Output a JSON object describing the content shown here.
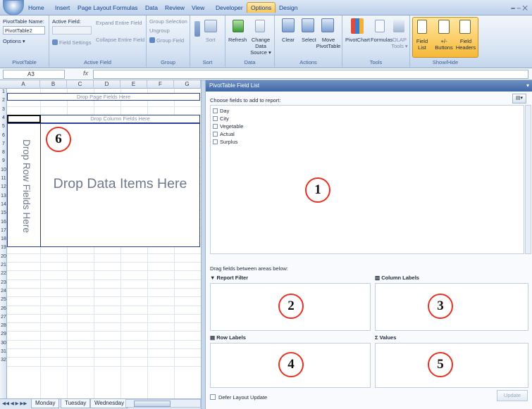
{
  "ribbon_tabs": [
    "Home",
    "Insert",
    "Page Layout",
    "Formulas",
    "Data",
    "Review",
    "View",
    "Developer",
    "Options",
    "Design"
  ],
  "active_tab": "Options",
  "window_controls": "🗕 – ✕",
  "ribbon": {
    "pivottable": {
      "name_label": "PivotTable Name:",
      "name_value": "PivotTable2",
      "options": "Options ▾",
      "group": "PivotTable"
    },
    "active_field": {
      "label": "Active Field:",
      "field_settings": "Field Settings",
      "expand": "Expand Entire Field",
      "collapse": "Collapse Entire Field",
      "group": "Active Field"
    },
    "group": {
      "selection": "Group Selection",
      "ungroup": "Ungroup",
      "field": "Group Field",
      "group": "Group"
    },
    "sort": {
      "sort": "Sort",
      "group": "Sort"
    },
    "data": {
      "refresh": "Refresh",
      "change_source": "Change Data Source ▾",
      "group": "Data"
    },
    "actions": {
      "clear": "Clear",
      "select": "Select",
      "move": "Move PivotTable",
      "group": "Actions"
    },
    "tools": {
      "pivotchart": "PivotChart",
      "formulas": "Formulas",
      "olap": "OLAP Tools ▾",
      "group": "Tools"
    },
    "showhide": {
      "field_list": "Field List",
      "buttons": "+/- Buttons",
      "headers": "Field Headers",
      "group": "Show/Hide"
    }
  },
  "formula_bar": {
    "namebox": "A3",
    "fx": "fx"
  },
  "sheet": {
    "columns": [
      "A",
      "B",
      "C",
      "D",
      "E",
      "F",
      "G"
    ],
    "rows": [
      "1",
      "2",
      "3",
      "4",
      "5",
      "6",
      "7",
      "8",
      "9",
      "10",
      "11",
      "12",
      "13",
      "14",
      "15",
      "16",
      "17",
      "18",
      "19",
      "20",
      "21",
      "22",
      "23",
      "24",
      "25",
      "26",
      "27",
      "28",
      "29",
      "30",
      "31",
      "32"
    ],
    "drop_page": "Drop Page Fields Here",
    "drop_column": "Drop Column Fields Here",
    "drop_row": "Drop Row Fields Here",
    "drop_data": "Drop Data Items Here",
    "tabs": [
      "Monday",
      "Tuesday",
      "Wednesday"
    ],
    "nav": "◀◀ ◀ ▶ ▶▶"
  },
  "field_list": {
    "title": "PivotTable Field List",
    "close": "▾",
    "choose_label": "Choose fields to add to report:",
    "layout_btn": "▤▾",
    "fields": [
      "Day",
      "City",
      "Vegetable",
      "Actual",
      "Surplus"
    ],
    "drag_label": "Drag fields between areas below:",
    "areas": {
      "filter": "Report Filter",
      "columns": "Column Labels",
      "rows": "Row Labels",
      "values": "Values"
    },
    "area_icons": {
      "filter": "▼",
      "columns": "▥",
      "rows": "▤",
      "values": "Σ"
    },
    "defer": "Defer Layout Update",
    "update": "Update"
  },
  "callouts": [
    "1",
    "2",
    "3",
    "4",
    "5",
    "6"
  ],
  "colors": {
    "accent": "#e53222",
    "frame": "#2e3f9a",
    "panel_title": "#3f67a6"
  }
}
